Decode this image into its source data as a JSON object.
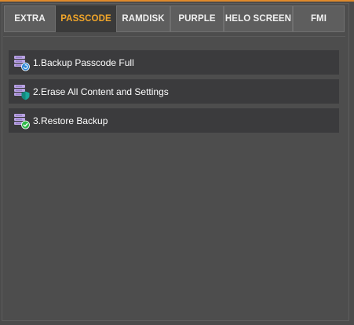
{
  "tabs": [
    {
      "label": "EXTRA",
      "active": false
    },
    {
      "label": "PASSCODE",
      "active": true
    },
    {
      "label": "RAMDISK",
      "active": false
    },
    {
      "label": "PURPLE",
      "active": false
    },
    {
      "label": "HELO SCREEN",
      "active": false
    },
    {
      "label": "FMI",
      "active": false
    }
  ],
  "menu": {
    "items": [
      {
        "label": "1.Backup Passcode Full",
        "icon": "database-backup-icon"
      },
      {
        "label": "2.Erase All Content and Settings",
        "icon": "database-shield-icon"
      },
      {
        "label": "3.Restore Backup",
        "icon": "database-check-icon"
      }
    ]
  },
  "colors": {
    "accent": "#f2a62a",
    "background": "#4b4b4b",
    "tab": "#5e5e5e",
    "tab_active": "#3a3a3a",
    "item": "#3b3b3d",
    "icon_db": "#b9a3e3",
    "icon_backup": "#2f86d6",
    "icon_shield": "#1aa89a",
    "icon_check": "#2fb84a"
  }
}
